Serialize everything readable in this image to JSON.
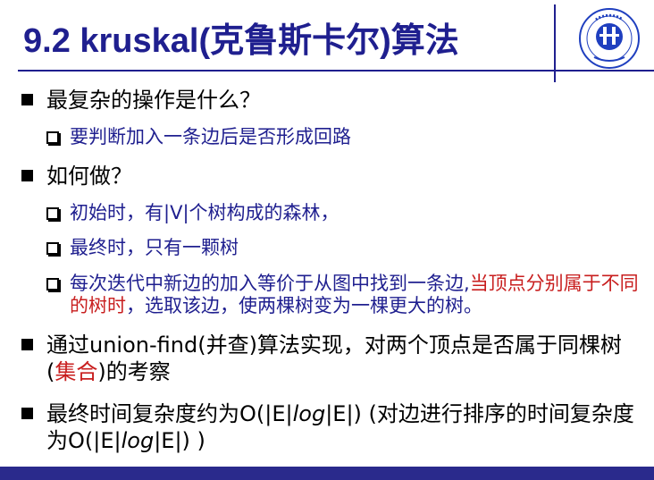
{
  "slide": {
    "title": "9.2 kruskal(克鲁斯卡尔)算法",
    "logo_text": "XAUT",
    "bullets": [
      {
        "text": "最复杂的操作是什么？"
      },
      {
        "text": "要判断加入一条边后是否形成回路"
      },
      {
        "text": "如何做？"
      },
      {
        "text": "初始时，有|V|个树构成的森林，"
      },
      {
        "text": "最终时，只有一颗树"
      },
      {
        "text_a": "每次迭代中新边的加入等价于从图中找到一条边,",
        "text_red": "当顶点分别属于不同的树时",
        "text_b": "，选取该边，使两棵树变为一棵更大的树。"
      },
      {
        "text_a": "通过union-find(并查)算法实现，对两个顶点是否属于同棵树(",
        "text_red": "集合",
        "text_b": ")的考察"
      },
      {
        "text_line1": "最终时间复杂度约为O(|E|",
        "text_ital1": "log",
        "text_line1b": "|E|) (对边进行排序的时间复杂度为O(|E|",
        "text_ital2": "log",
        "text_line1c": "|E|) )"
      }
    ]
  },
  "colors": {
    "primary": "#1f1f8f",
    "accent_red": "#c81e1e",
    "bar": "#2a2a8c"
  }
}
